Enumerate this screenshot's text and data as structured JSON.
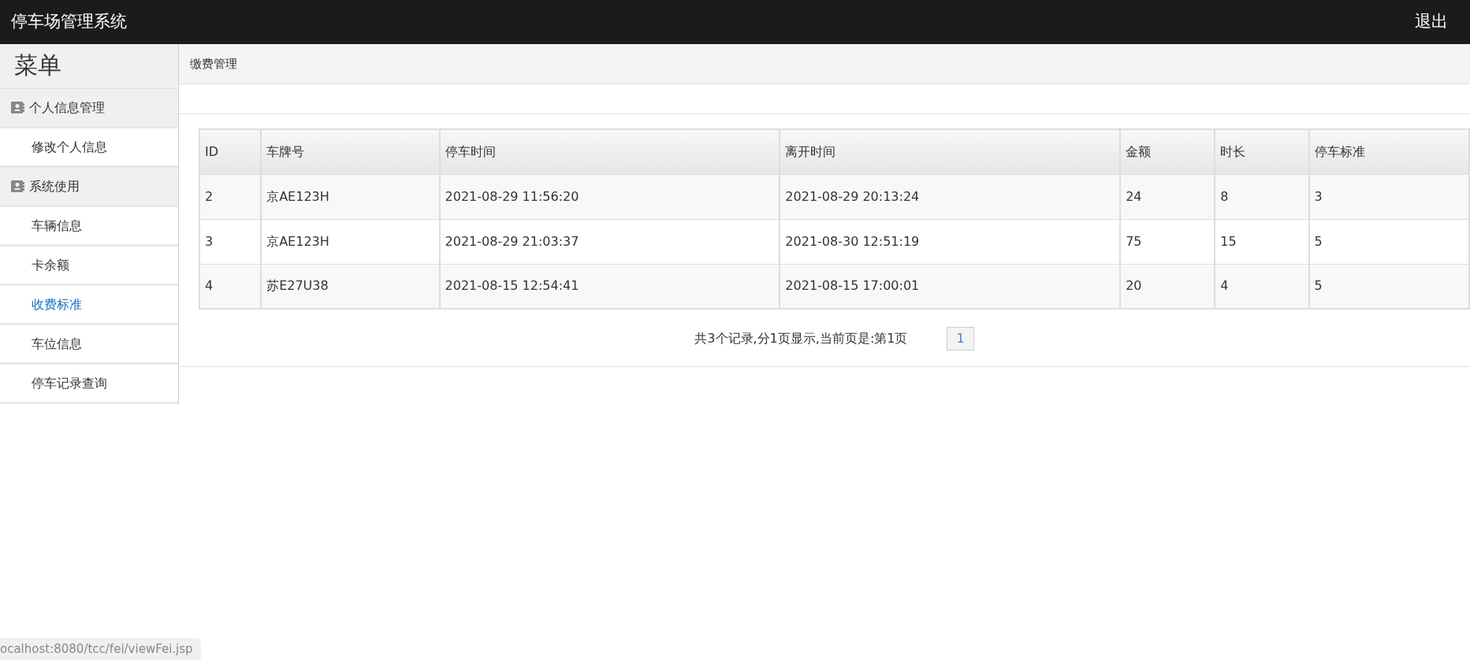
{
  "navbar": {
    "title": "停车场管理系统",
    "logout": "退出"
  },
  "sidebar": {
    "heading": "菜单",
    "groups": [
      {
        "label": "个人信息管理",
        "items": [
          {
            "label": "修改个人信息",
            "selected": false
          }
        ]
      },
      {
        "label": "系统使用",
        "items": [
          {
            "label": "车辆信息",
            "selected": false
          },
          {
            "label": "卡余额",
            "selected": false
          },
          {
            "label": "收费标准",
            "selected": true
          },
          {
            "label": "车位信息",
            "selected": false
          },
          {
            "label": "停车记录查询",
            "selected": false
          }
        ]
      }
    ]
  },
  "breadcrumb": "缴费管理",
  "table": {
    "columns": [
      "ID",
      "车牌号",
      "停车时间",
      "离开时间",
      "金额",
      "时长",
      "停车标准"
    ],
    "rows": [
      [
        "2",
        "京AE123H",
        "2021-08-29 11:56:20",
        "2021-08-29 20:13:24",
        "24",
        "8",
        "3"
      ],
      [
        "3",
        "京AE123H",
        "2021-08-29 21:03:37",
        "2021-08-30 12:51:19",
        "75",
        "15",
        "5"
      ],
      [
        "4",
        "苏E27U38",
        "2021-08-15 12:54:41",
        "2021-08-15 17:00:01",
        "20",
        "4",
        "5"
      ]
    ]
  },
  "pagination": {
    "summary": "共3个记录,分1页显示,当前页是:第1页",
    "pages": [
      {
        "label": "1",
        "selected": true
      }
    ]
  },
  "status_bar": "ocalhost:8080/tcc/fei/viewFei.jsp"
}
